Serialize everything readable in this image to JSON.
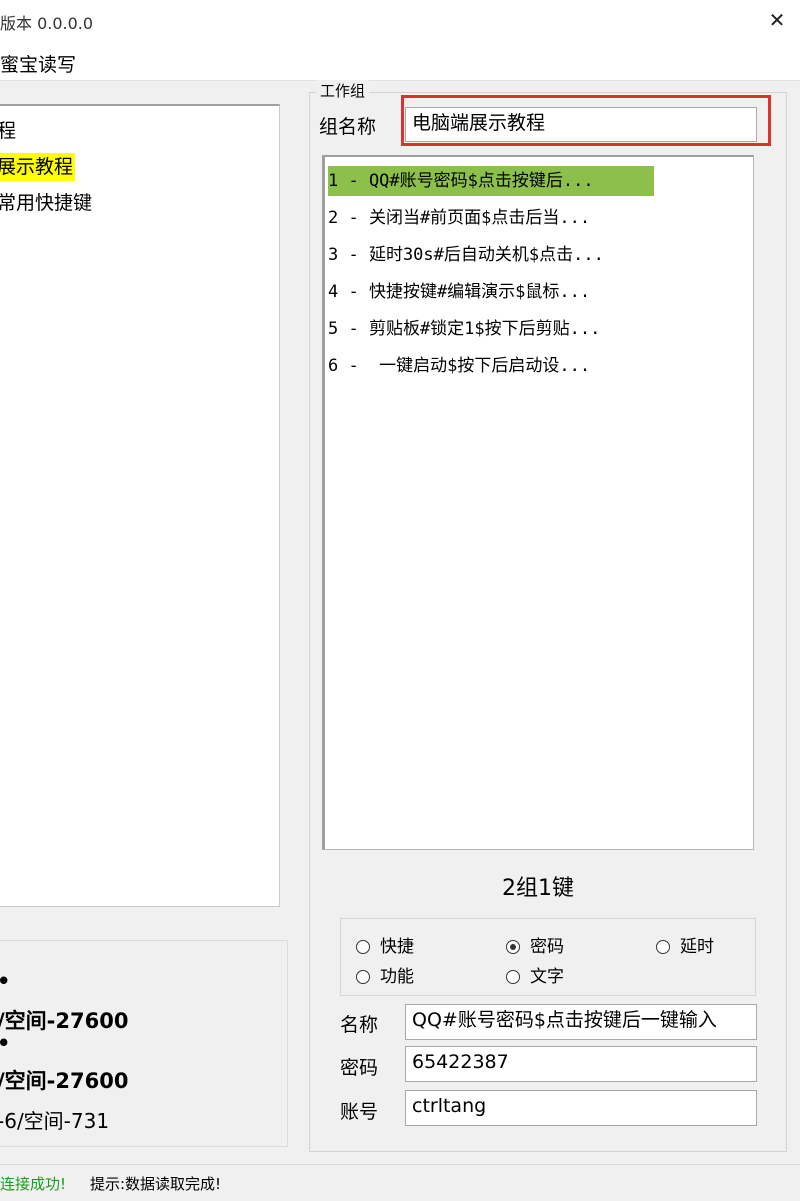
{
  "window": {
    "title": "版本 0.0.0.0",
    "close_glyph": "✕"
  },
  "menu": {
    "item": "蜜宝读写"
  },
  "tree": {
    "items": [
      {
        "label": "程",
        "highlighted": false
      },
      {
        "label": "展示教程",
        "highlighted": true
      },
      {
        "label": "常用快捷键",
        "highlighted": false
      }
    ]
  },
  "left_info": {
    "bullet1": "•",
    "line1": "/空间-27600",
    "bullet2": "•",
    "line2": "/空间-27600",
    "line3": "-6/空间-731"
  },
  "workgroup": {
    "legend": "工作组",
    "name_label": "组名称",
    "name_value": "电脑端展示教程",
    "list_items": [
      "1 - QQ#账号密码$点击按键后...",
      "2 - 关闭当#前页面$点击后当...",
      "3 - 延时30s#后自动关机$点击...",
      "4 - 快捷按键#编辑演示$鼠标...",
      "5 - 剪贴板#锁定1$按下后剪贴...",
      "6 -  一键启动$按下后启动设..."
    ],
    "selected_index": 0,
    "key_count": "2组1键",
    "radios": [
      {
        "label": "快捷",
        "checked": false
      },
      {
        "label": "密码",
        "checked": true
      },
      {
        "label": "延时",
        "checked": false
      },
      {
        "label": "功能",
        "checked": false
      },
      {
        "label": "文字",
        "checked": false
      }
    ],
    "fields": {
      "name_label": "名称",
      "name_value": "QQ#账号密码$点击按键后一键输入",
      "password_label": "密码",
      "password_value": "65422387",
      "account_label": "账号",
      "account_value": "ctrltang"
    }
  },
  "status": {
    "connection": "连接成功!",
    "hint": "提示:数据读取完成!"
  },
  "colors": {
    "highlight": "#ffff00",
    "selected_row": "#8cc04b",
    "red_box": "#e03131",
    "status_green": "#1e9a1e"
  }
}
